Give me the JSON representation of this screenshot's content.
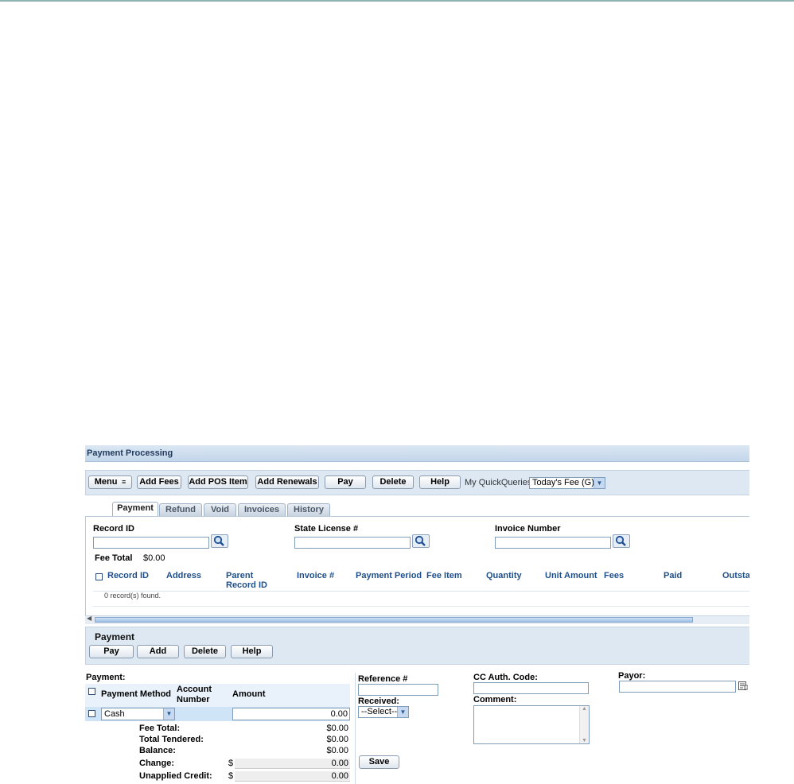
{
  "page": {
    "title": "Payment Processing"
  },
  "toolbar": {
    "menu_label": "Menu",
    "add_fees_label": "Add Fees",
    "add_pos_item_label": "Add POS Item",
    "add_renewals_label": "Add Renewals",
    "pay_label": "Pay",
    "delete_label": "Delete",
    "help_label": "Help",
    "quickqueries_label": "My QuickQueries",
    "quickqueries_selected": "Today's Fee (G)"
  },
  "tabs": [
    "Payment",
    "Refund",
    "Void",
    "Invoices",
    "History"
  ],
  "search": {
    "record_id_label": "Record ID",
    "state_license_label": "State License #",
    "invoice_number_label": "Invoice Number",
    "record_id_value": "",
    "state_license_value": "",
    "invoice_number_value": ""
  },
  "fee_total": {
    "label": "Fee Total",
    "value": "$0.00"
  },
  "grid": {
    "columns": [
      "Record ID",
      "Address",
      "Parent Record ID",
      "Invoice #",
      "Payment Period",
      "Fee Item",
      "Quantity",
      "Unit Amount",
      "Fees",
      "Paid",
      "Outstanding"
    ],
    "empty_message": "0 record(s) found."
  },
  "payment_box": {
    "title": "Payment",
    "pay_label": "Pay",
    "add_label": "Add",
    "delete_label": "Delete",
    "help_label": "Help"
  },
  "payment_form": {
    "section_label": "Payment:",
    "col_method": "Payment Method",
    "col_account": "Account Number",
    "col_amount": "Amount",
    "row_method": "Cash",
    "row_amount": "0.00",
    "summary": {
      "fee_total_label": "Fee Total:",
      "fee_total_value": "$0.00",
      "total_tendered_label": "Total Tendered:",
      "total_tendered_value": "$0.00",
      "balance_label": "Balance:",
      "balance_value": "$0.00",
      "change_label": "Change:",
      "change_currency": "$",
      "change_value": "0.00",
      "unapplied_label": "Unapplied Credit:",
      "unapplied_currency": "$",
      "unapplied_value": "0.00"
    },
    "reference_label": "Reference #",
    "reference_value": "",
    "received_label": "Received:",
    "received_selected": "--Select--",
    "cc_auth_label": "CC Auth. Code:",
    "cc_auth_value": "",
    "comment_label": "Comment:",
    "comment_value": "",
    "payor_label": "Payor:",
    "payor_value": "",
    "save_label": "Save"
  }
}
